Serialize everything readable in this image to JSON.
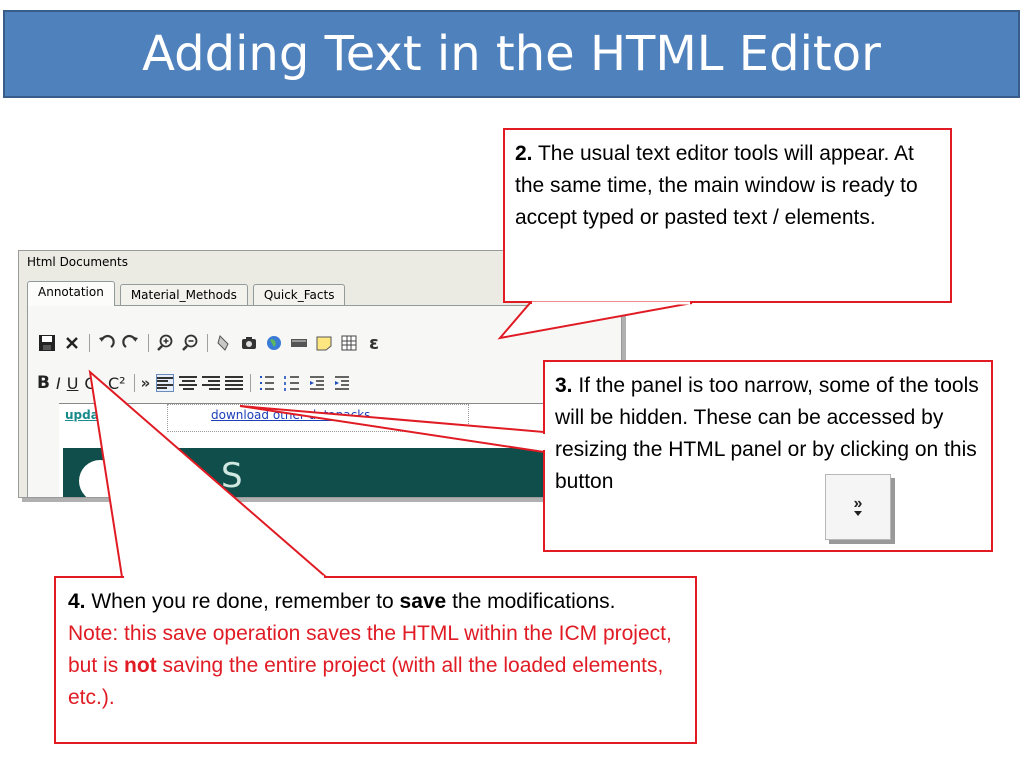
{
  "slide": {
    "title": "Adding Text in the HTML Editor"
  },
  "panel": {
    "title": "Html Documents",
    "tabs": [
      {
        "label": "Annotation"
      },
      {
        "label": "Material_Methods"
      },
      {
        "label": "Quick_Facts"
      }
    ],
    "toolbar1": {
      "icons": [
        "save-icon",
        "close-icon",
        "undo-icon",
        "redo-icon",
        "zoom-in-icon",
        "zoom-out-icon",
        "image-icon",
        "camera-icon",
        "globe-icon",
        "line-icon",
        "note-icon",
        "table-icon",
        "epsilon-icon"
      ]
    },
    "toolbar2": {
      "bold": "B",
      "italic": "I",
      "underline": "U",
      "subscript": "C₂",
      "superscript": "C²",
      "more": "»"
    },
    "content": {
      "link_update": "update",
      "link_download": "download other datapacks"
    }
  },
  "callout2": {
    "number": "2.",
    "text": " The usual text editor tools will appear. At the same time, the main window is ready to accept typed or pasted text / elements."
  },
  "callout3": {
    "number": "3.",
    "text": " If the panel is too narrow, some of the tools will be hidden. These can be accessed by resizing the HTML panel or by clicking on this button",
    "button_glyph": "»"
  },
  "callout4": {
    "number": "4.",
    "text_before": " When you re done, remember to ",
    "save_word": "save",
    "text_after": " the modifications.",
    "note_before": "Note: this save operation saves the HTML within the ICM project, but is ",
    "note_bold": "not",
    "note_after": " saving the entire project (with all the loaded elements, etc.)."
  },
  "colors": {
    "title_bg": "#4f81bd",
    "callout_border": "#e01b24",
    "note_text": "#e01b24"
  }
}
